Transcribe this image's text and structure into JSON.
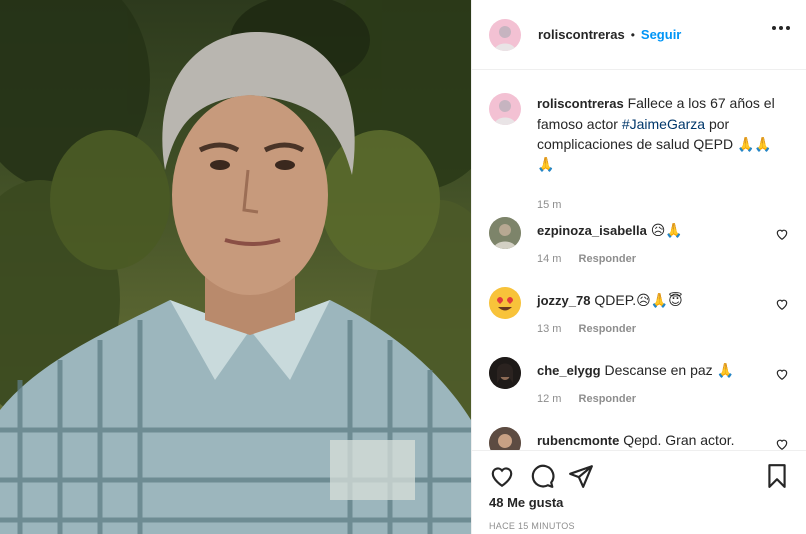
{
  "post": {
    "author": "roliscontreras",
    "separator": "•",
    "follow_label": "Seguir",
    "more_icon": "more-horizontal-icon"
  },
  "caption": {
    "username": "roliscontreras",
    "text_before": "Fallece a los 67 años el famoso actor ",
    "hashtag": "#JaimeGarza",
    "text_after": " por complicaciones de salud QEPD 🙏🙏🙏",
    "time": "15 m"
  },
  "comments": [
    {
      "username": "ezpinoza_isabella",
      "text": "😥🙏",
      "time": "14 m",
      "reply_label": "Responder"
    },
    {
      "username": "jozzy_78",
      "text": "QDEP.😥🙏😇",
      "time": "13 m",
      "reply_label": "Responder"
    },
    {
      "username": "che_elygg",
      "text": "Descanse en paz 🙏",
      "time": "12 m",
      "reply_label": "Responder"
    },
    {
      "username": "rubencmonte",
      "text": "Qepd. Gran actor.",
      "time": "",
      "reply_label": ""
    }
  ],
  "actions": {
    "like_icon": "heart-icon",
    "comment_icon": "comment-icon",
    "share_icon": "paper-plane-icon",
    "save_icon": "bookmark-icon"
  },
  "likes_text": "48 Me gusta",
  "posted_ago": "HACE 15 MINUTOS",
  "colors": {
    "follow": "#0095f6",
    "text": "#262626",
    "muted": "#8e8e8e",
    "border": "#efefef"
  }
}
